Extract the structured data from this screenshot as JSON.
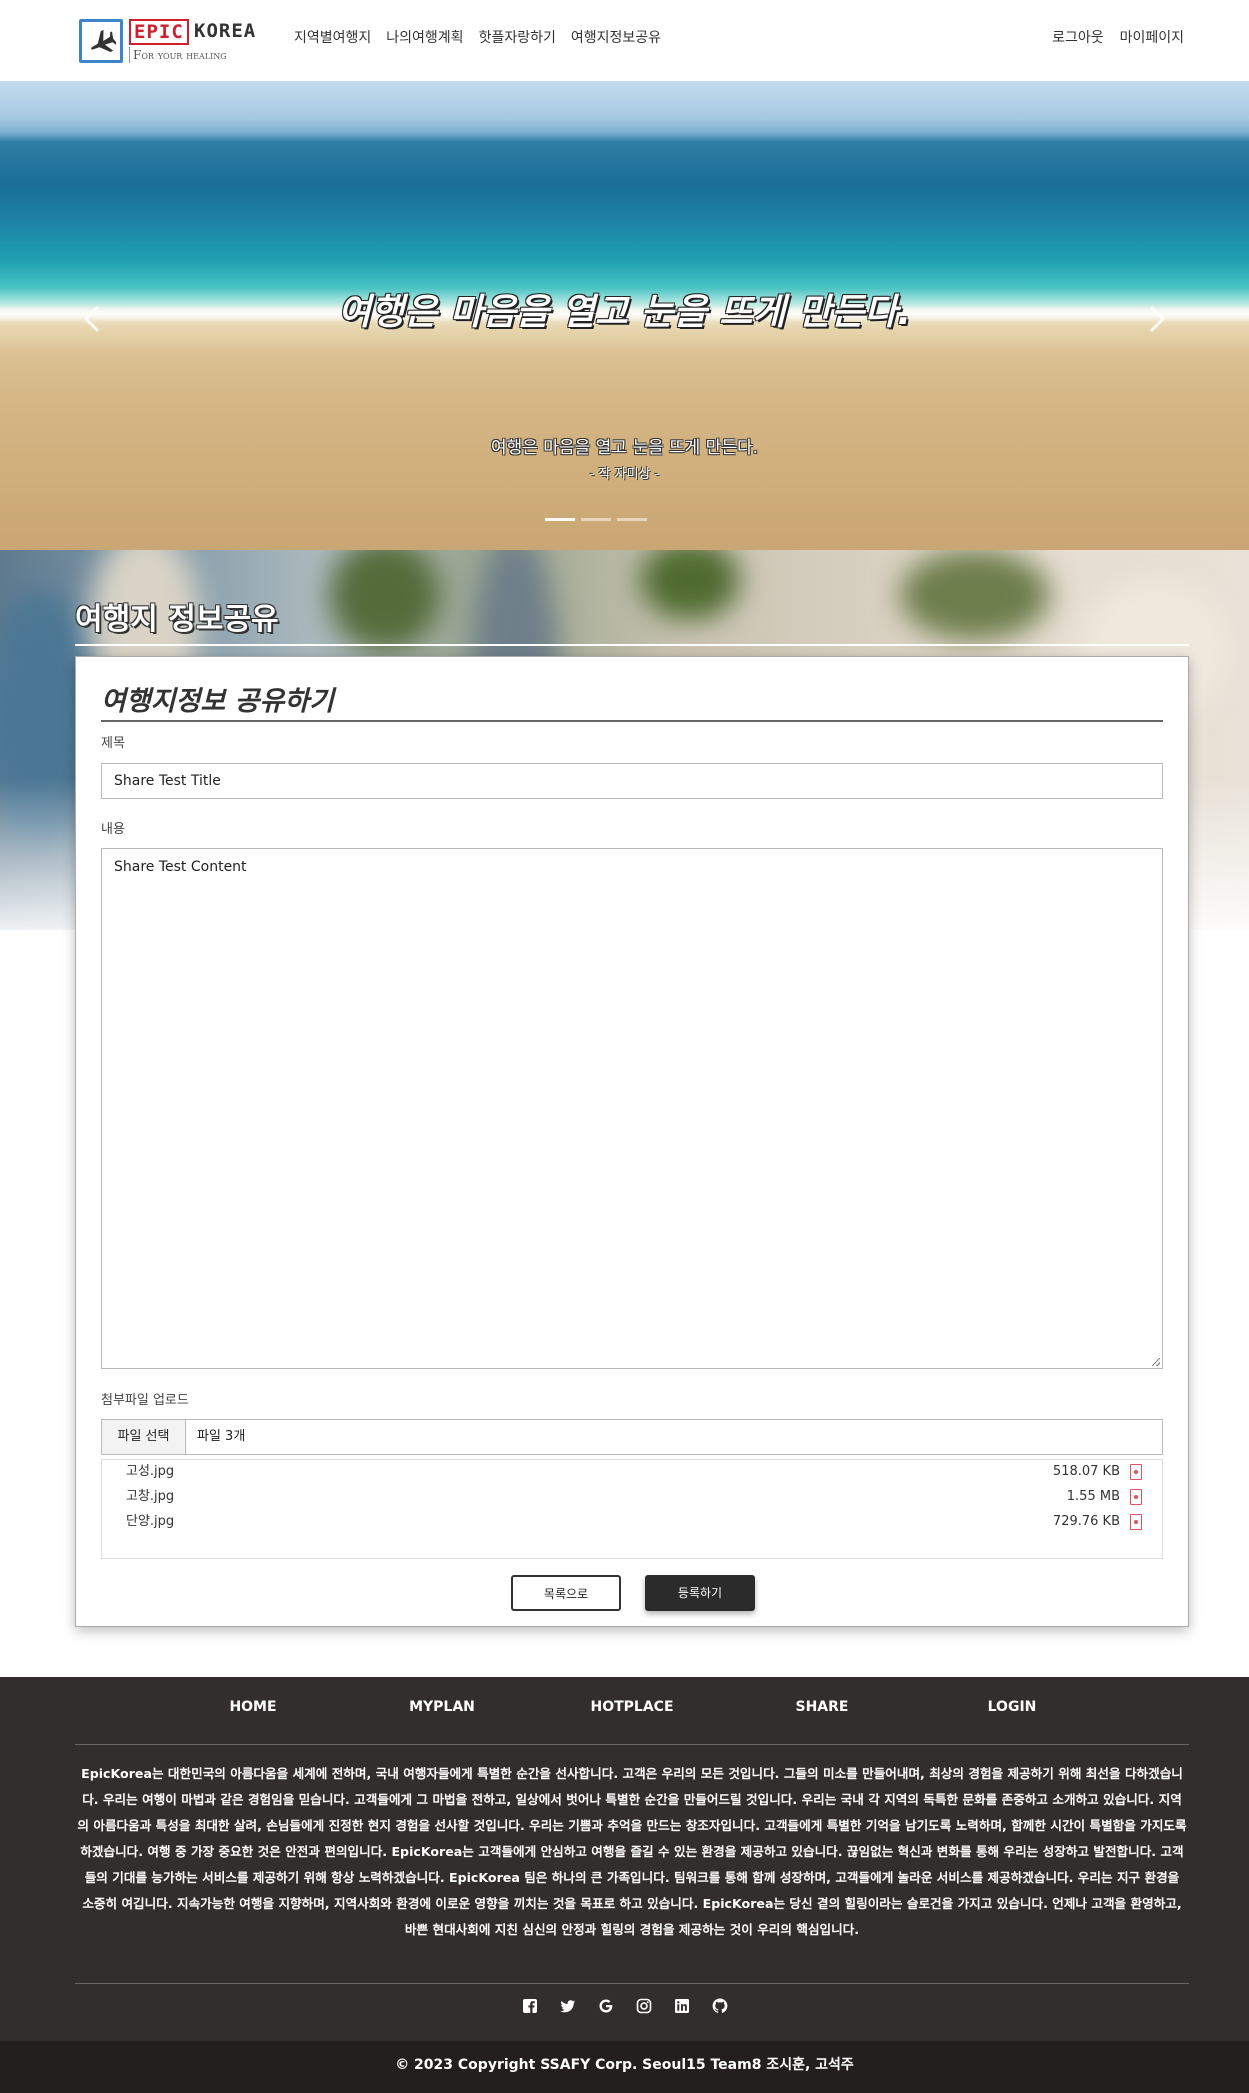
{
  "logo": {
    "brand_red": "EPIC",
    "brand_dark": "KOREA",
    "tagline": "For your healing"
  },
  "nav": {
    "items": [
      "지역별여행지",
      "나의여행계획",
      "핫플자랑하기",
      "여행지정보공유"
    ],
    "logout": "로그아웃",
    "mypage": "마이페이지"
  },
  "hero": {
    "title": "여행은 마음을 열고 눈을 뜨게 만든다.",
    "caption": "여행은 마음을 열고 눈을 뜨게 만든다.",
    "author": "- 작 자미상 -",
    "slide_count": 3,
    "active_slide": 1
  },
  "section": {
    "title": "여행지 정보공유"
  },
  "form": {
    "heading": "여행지정보 공유하기",
    "title_label": "제목",
    "title_value": "Share Test Title",
    "content_label": "내용",
    "content_value": "Share Test Content",
    "file_label": "첨부파일 업로드",
    "file_button": "파일 선택",
    "file_status": "파일 3개",
    "files": [
      {
        "name": "고성.jpg",
        "size": "518.07 KB"
      },
      {
        "name": "고창.jpg",
        "size": "1.55 MB"
      },
      {
        "name": "단양.jpg",
        "size": "729.76 KB"
      }
    ],
    "list_button": "목록으로",
    "submit_button": "등록하기"
  },
  "footer": {
    "nav": [
      "HOME",
      "MYPLAN",
      "HOTPLACE",
      "SHARE",
      "LOGIN"
    ],
    "description": "EpicKorea는 대한민국의 아름다움을 세계에 전하며, 국내 여행자들에게 특별한 순간을 선사합니다. 고객은 우리의 모든 것입니다. 그들의 미소를 만들어내며, 최상의 경험을 제공하기 위해 최선을 다하겠습니다. 우리는 여행이 마법과 같은 경험임을 믿습니다. 고객들에게 그 마법을 전하고, 일상에서 벗어나 특별한 순간을 만들어드릴 것입니다. 우리는 국내 각 지역의 독특한 문화를 존중하고 소개하고 있습니다. 지역의 아름다움과 특성을 최대한 살려, 손님들에게 진정한 현지 경험을 선사할 것입니다. 우리는 기쁨과 추억을 만드는 창조자입니다. 고객들에게 특별한 기억을 남기도록 노력하며, 함께한 시간이 특별함을 가지도록 하겠습니다. 여행 중 가장 중요한 것은 안전과 편의입니다. EpicKorea는 고객들에게 안심하고 여행을 즐길 수 있는 환경을 제공하고 있습니다. 끊임없는 혁신과 변화를 통해 우리는 성장하고 발전합니다. 고객들의 기대를 능가하는 서비스를 제공하기 위해 항상 노력하겠습니다. EpicKorea 팀은 하나의 큰 가족입니다. 팀워크를 통해 함께 성장하며, 고객들에게 놀라운 서비스를 제공하겠습니다. 우리는 지구 환경을 소중히 여깁니다. 지속가능한 여행을 지향하며, 지역사회와 환경에 이로운 영향을 끼치는 것을 목표로 하고 있습니다. EpicKorea는 당신 곁의 힐링이라는 슬로건을 가지고 있습니다. 언제나 고객을 환영하고, 바쁜 현대사회에 지친 심신의 안정과 힐링의 경험을 제공하는 것이 우리의 핵심입니다.",
    "social": [
      "facebook-icon",
      "twitter-icon",
      "google-icon",
      "instagram-icon",
      "linkedin-icon",
      "github-icon"
    ],
    "copyright": "© 2023 Copyright SSAFY Corp. Seoul15 Team8 조시훈, 고석주"
  },
  "colors": {
    "brand_red": "#cf2030",
    "logo_blue": "#3a86c8",
    "footer_bg": "#332e2e",
    "copyright_bg": "#231f1f",
    "submit_bg": "#2b2b2b"
  }
}
